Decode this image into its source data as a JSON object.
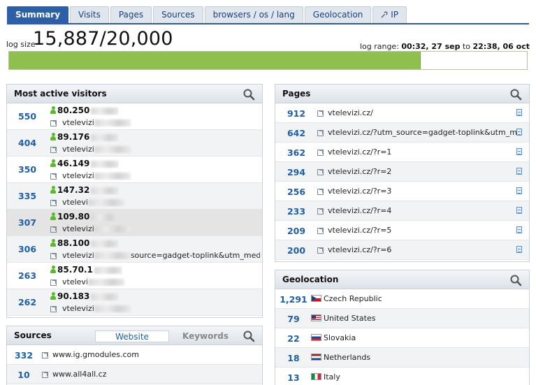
{
  "tabs": [
    "Summary",
    "Visits",
    "Pages",
    "Sources",
    "browsers / os / lang",
    "Geolocation",
    "IP"
  ],
  "log_size": {
    "label": "log size",
    "value": "15,887/20,000",
    "used": 15887,
    "max": 20000
  },
  "log_range": {
    "label": "log range:",
    "from": "00:32, 27 sep",
    "to_word": "to",
    "to": "22:38, 06 oct"
  },
  "visitors": {
    "title": "Most active visitors",
    "rows": [
      {
        "count": "550",
        "ip": "80.250",
        "ref": "vtelevizi"
      },
      {
        "count": "404",
        "ip": "89.176",
        "ref": "vtelevizi"
      },
      {
        "count": "350",
        "ip": "46.149",
        "ref": "vtelevizi"
      },
      {
        "count": "335",
        "ip": "147.32",
        "ref": "vtelevi"
      },
      {
        "count": "307",
        "ip": "109.80",
        "ref": "vtelevizi"
      },
      {
        "count": "306",
        "ip": "88.100",
        "ref": "vtelevizi",
        "ref_tail": "source=gadget-toplink&utm_medium=ga"
      },
      {
        "count": "263",
        "ip": "85.70.1",
        "ref": "vtelevi"
      },
      {
        "count": "262",
        "ip": "90.183",
        "ref": "vtelevizi"
      }
    ]
  },
  "sources": {
    "title": "Sources",
    "tab_website": "Website",
    "tab_keywords": "Keywords",
    "rows": [
      {
        "count": "332",
        "site": "www.ig.gmodules.com"
      },
      {
        "count": "10",
        "site": "www.all4all.cz"
      }
    ]
  },
  "pages": {
    "title": "Pages",
    "rows": [
      {
        "count": "912",
        "url": "vtelevizi.cz/"
      },
      {
        "count": "642",
        "url": "vtelevizi.cz/?utm_source=gadget-toplink&utm_medium="
      },
      {
        "count": "362",
        "url": "vtelevizi.cz/?r=1"
      },
      {
        "count": "294",
        "url": "vtelevizi.cz/?r=2"
      },
      {
        "count": "256",
        "url": "vtelevizi.cz/?r=3"
      },
      {
        "count": "233",
        "url": "vtelevizi.cz/?r=4"
      },
      {
        "count": "209",
        "url": "vtelevizi.cz/?r=5"
      },
      {
        "count": "200",
        "url": "vtelevizi.cz/?r=6"
      }
    ]
  },
  "geo": {
    "title": "Geolocation",
    "rows": [
      {
        "count": "1,291",
        "country": "Czech Republic",
        "flag": "cz-flag-icon"
      },
      {
        "count": "79",
        "country": "United States",
        "flag": "us-flag-icon"
      },
      {
        "count": "22",
        "country": "Slovakia",
        "flag": "sk-flag-icon"
      },
      {
        "count": "18",
        "country": "Netherlands",
        "flag": "nl-flag-icon"
      },
      {
        "count": "13",
        "country": "Italy",
        "flag": "it-flag-icon"
      }
    ]
  },
  "colors": {
    "accent": "#2c5fa5",
    "link_number": "#1f5fa8",
    "bar_fill": "#8fbf4d",
    "online": "#5cb82e"
  }
}
